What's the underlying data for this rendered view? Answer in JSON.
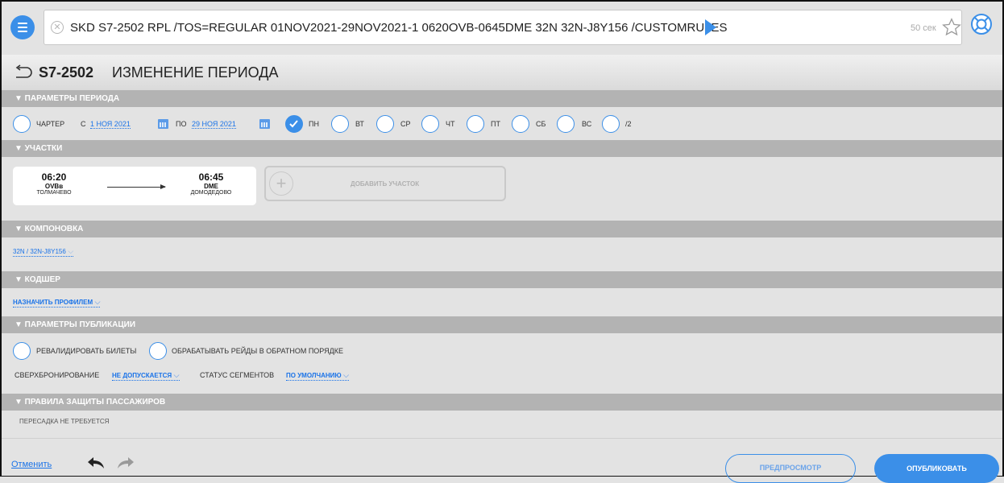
{
  "command": {
    "text": "SKD S7-2502 RPL /TOS=REGULAR 01NOV2021-29NOV2021-1 0620OVB-0645DME 32N 32N-J8Y156 /CUSTOMRULES",
    "timer": "50 сек"
  },
  "header": {
    "flight": "S7-2502",
    "title": "ИЗМЕНЕНИЕ ПЕРИОДА"
  },
  "period": {
    "header": "▼ ПАРАМЕТРЫ ПЕРИОДА",
    "charter": "ЧАРТЕР",
    "from_label": "С",
    "from_date": "1 НОЯ 2021",
    "to_label": "ПО",
    "to_date": "29 НОЯ 2021",
    "days": [
      {
        "label": "ПН",
        "checked": true
      },
      {
        "label": "ВТ",
        "checked": false
      },
      {
        "label": "СР",
        "checked": false
      },
      {
        "label": "ЧТ",
        "checked": false
      },
      {
        "label": "ПТ",
        "checked": false
      },
      {
        "label": "СБ",
        "checked": false
      },
      {
        "label": "ВС",
        "checked": false
      },
      {
        "label": "/2",
        "checked": false
      }
    ]
  },
  "legs": {
    "header": "▼ УЧАСТКИ",
    "dep_time": "06:20",
    "dep_code": "OVBв",
    "dep_name": "ТОЛМАЧЕВО",
    "arr_time": "06:45",
    "arr_code": "DME",
    "arr_name": "ДОМОДЕДОВО",
    "add_label": "ДОБАВИТЬ УЧАСТОК"
  },
  "config": {
    "header": "▼ КОМПОНОВКА",
    "value": "32N / 32N-J8Y156"
  },
  "codeshare": {
    "header": "▼ КОДШЕР",
    "value": "НАЗНАЧИТЬ ПРОФИЛЕМ"
  },
  "publish_params": {
    "header": "▼ ПАРАМЕТРЫ ПУБЛИКАЦИИ",
    "revalidate": "РЕВАЛИДИРОВАТЬ БИЛЕТЫ",
    "reverse": "ОБРАБАТЫВАТЬ РЕЙДЫ В ОБРАТНОМ ПОРЯДКЕ",
    "overbooking_label": "СВЕРХБРОНИРОВАНИЕ",
    "overbooking_value": "НЕ ДОПУСКАЕТСЯ",
    "segment_status_label": "СТАТУС СЕГМЕНТОВ",
    "segment_status_value": "ПО УМОЛЧАНИЮ"
  },
  "protection": {
    "header": "▼ ПРАВИЛА ЗАЩИТЫ ПАССАЖИРОВ",
    "text": "ПЕРЕСАДКА НЕ ТРЕБУЕТСЯ"
  },
  "footer": {
    "cancel": "Отменить",
    "preview": "ПРЕДПРОСМОТР",
    "publish": "ОПУБЛИКОВАТЬ"
  },
  "colors": {
    "accent": "#3b8fe8",
    "section_header": "#b3b3b3",
    "background": "#e3e3e3"
  },
  "icons": [
    "menu-icon",
    "clear-icon",
    "run-icon",
    "star-icon",
    "help-icon",
    "back-icon",
    "calendar-icon",
    "check-icon",
    "arrow-right-icon",
    "plus-icon",
    "chevron-down-icon",
    "undo-icon",
    "redo-icon"
  ]
}
